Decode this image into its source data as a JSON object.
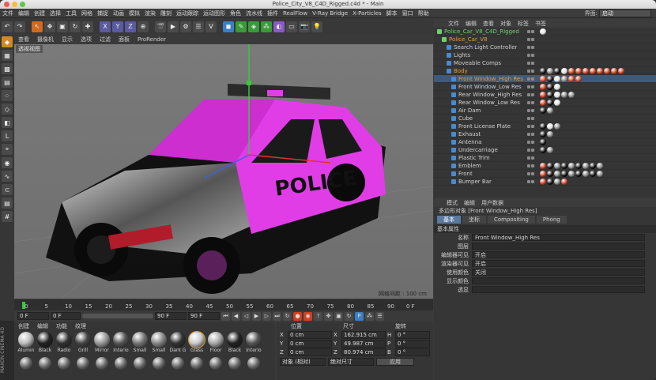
{
  "window": {
    "title": "Police_City_V8_C4D_Rigged.c4d * - Main"
  },
  "menu": [
    "文件",
    "编辑",
    "创建",
    "选择",
    "工具",
    "网格",
    "捕捉",
    "动画",
    "模拟",
    "渲染",
    "雕刻",
    "运动跟踪",
    "运动图形",
    "角色",
    "流水线",
    "插件",
    "RealFlow",
    "V-Ray Bridge",
    "X-Particles",
    "脚本",
    "窗口",
    "帮助"
  ],
  "layout": {
    "label": "界面:",
    "value": "启动"
  },
  "viewport": {
    "menu": [
      "查看",
      "摄像机",
      "显示",
      "选项",
      "过滤",
      "面板",
      "ProRender"
    ],
    "name": "透视视图",
    "grid_label": "网格间距 : 100 cm",
    "car_text": "POLICE"
  },
  "timeline": {
    "ticks": [
      "0",
      "5",
      "10",
      "15",
      "20",
      "25",
      "30",
      "35",
      "40",
      "45",
      "50",
      "55",
      "60",
      "65",
      "70",
      "75",
      "80",
      "85",
      "90"
    ],
    "end": "0 F"
  },
  "transport": {
    "start": "0 F",
    "cur": "0 F",
    "end1": "90 F",
    "end2": "90 F"
  },
  "materials": {
    "menu": [
      "创建",
      "编辑",
      "功能",
      "纹理"
    ],
    "row1": [
      "Alumin",
      "Black",
      "Radio",
      "Grill",
      "Mirror",
      "Interio",
      "Small",
      "Small",
      "Dark G",
      "Glass",
      "Floor",
      "Black",
      "Interio"
    ],
    "row2": [
      "",
      "",
      "",
      "",
      "",
      "",
      "",
      "",
      "",
      "",
      "",
      "",
      ""
    ]
  },
  "brand": "MAXON CINEMA 4D",
  "coordinates": {
    "heads": [
      "位置",
      "尺寸",
      "旋转"
    ],
    "rows": [
      {
        "axis": "X",
        "pos": "0 cm",
        "size": "162.915 cm",
        "rl": "H",
        "rot": "0 °"
      },
      {
        "axis": "Y",
        "pos": "0 cm",
        "size": "49.987 cm",
        "rl": "P",
        "rot": "0 °"
      },
      {
        "axis": "Z",
        "pos": "0 cm",
        "size": "80.974 cm",
        "rl": "B",
        "rot": "0 °"
      }
    ],
    "mode1": "对象 (相对)",
    "mode2": "绝对尺寸",
    "apply": "应用"
  },
  "objects": {
    "menu": [
      "文件",
      "编辑",
      "查看",
      "对象",
      "标签",
      "书签"
    ],
    "items": [
      {
        "name": "Police_Car_V8_C4D_Rigged",
        "indent": 0,
        "color": "#6fd06f",
        "sel": false,
        "tags": [
          "#e0e0e0"
        ]
      },
      {
        "name": "Police_Car_V8",
        "indent": 1,
        "color": "#e0a040",
        "sel": false,
        "tags": []
      },
      {
        "name": "Search Light Controller",
        "indent": 2,
        "color": "#cfcfcf",
        "sel": false,
        "tags": []
      },
      {
        "name": "Lights",
        "indent": 2,
        "color": "#cfcfcf",
        "sel": false,
        "tags": []
      },
      {
        "name": "Moveable Comps",
        "indent": 2,
        "color": "#cfcfcf",
        "sel": false,
        "tags": []
      },
      {
        "name": "Body",
        "indent": 2,
        "color": "#e0a040",
        "sel": false,
        "tags": [
          "#111",
          "#888",
          "#111",
          "#ddd",
          "#d04020",
          "#d04020",
          "#d04020",
          "#d04020",
          "#d04020",
          "#d04020",
          "#d04020",
          "#d04020"
        ]
      },
      {
        "name": "Front Window_High Res",
        "indent": 3,
        "color": "#e0a040",
        "sel": true,
        "tags": [
          "#d04020",
          "#111",
          "#e0e0e0",
          "#888",
          "#d04020",
          "#d04020"
        ]
      },
      {
        "name": "Front Window_Low Res",
        "indent": 3,
        "color": "#cfcfcf",
        "sel": false,
        "tags": [
          "#d04020",
          "#111",
          "#e0e0e0"
        ]
      },
      {
        "name": "Rear Window_High Res",
        "indent": 3,
        "color": "#cfcfcf",
        "sel": false,
        "tags": [
          "#d04020",
          "#111",
          "#e0e0e0",
          "#888",
          "#888"
        ]
      },
      {
        "name": "Rear Window_Low Res",
        "indent": 3,
        "color": "#cfcfcf",
        "sel": false,
        "tags": [
          "#d04020",
          "#111",
          "#e0e0e0"
        ]
      },
      {
        "name": "Air Dam",
        "indent": 3,
        "color": "#cfcfcf",
        "sel": false,
        "tags": [
          "#111",
          "#888"
        ]
      },
      {
        "name": "Cube",
        "indent": 3,
        "color": "#cfcfcf",
        "sel": false,
        "tags": []
      },
      {
        "name": "Front License Plate",
        "indent": 3,
        "color": "#cfcfcf",
        "sel": false,
        "tags": [
          "#111",
          "#e0e0e0",
          "#888"
        ]
      },
      {
        "name": "Exhaust",
        "indent": 3,
        "color": "#cfcfcf",
        "sel": false,
        "tags": [
          "#111",
          "#888"
        ]
      },
      {
        "name": "Antenna",
        "indent": 3,
        "color": "#cfcfcf",
        "sel": false,
        "tags": [
          "#111"
        ]
      },
      {
        "name": "Undercarriage",
        "indent": 3,
        "color": "#cfcfcf",
        "sel": false,
        "tags": [
          "#111",
          "#888"
        ]
      },
      {
        "name": "Plastic Trim",
        "indent": 3,
        "color": "#cfcfcf",
        "sel": false,
        "tags": []
      },
      {
        "name": "Emblem",
        "indent": 3,
        "color": "#cfcfcf",
        "sel": false,
        "tags": [
          "#d04020",
          "#111",
          "#888",
          "#111",
          "#888",
          "#111",
          "#888",
          "#111",
          "#888"
        ]
      },
      {
        "name": "Front",
        "indent": 3,
        "color": "#cfcfcf",
        "sel": false,
        "tags": [
          "#d04020",
          "#111",
          "#888",
          "#111",
          "#888",
          "#111",
          "#888",
          "#111",
          "#888"
        ]
      },
      {
        "name": "Bumper Bar",
        "indent": 3,
        "color": "#cfcfcf",
        "sel": false,
        "tags": [
          "#d04020",
          "#111",
          "#888",
          "#d04020"
        ]
      }
    ]
  },
  "attributes": {
    "menu": [
      "模式",
      "编辑",
      "用户数据"
    ],
    "title": "多边形对象 [Front Window_High Res]",
    "tabs": [
      "基本",
      "坐标",
      "Compositing",
      "Phong"
    ],
    "section": "基本属性",
    "rows": [
      {
        "label": "名称",
        "value": "Front Window_High Res"
      },
      {
        "label": "图层",
        "value": ""
      },
      {
        "label": "编辑器可见",
        "value": "开启"
      },
      {
        "label": "渲染器可见",
        "value": "开启"
      },
      {
        "label": "使用颜色",
        "value": "关闭"
      },
      {
        "label": "显示颜色",
        "value": ""
      },
      {
        "label": "透显",
        "value": ""
      }
    ]
  }
}
